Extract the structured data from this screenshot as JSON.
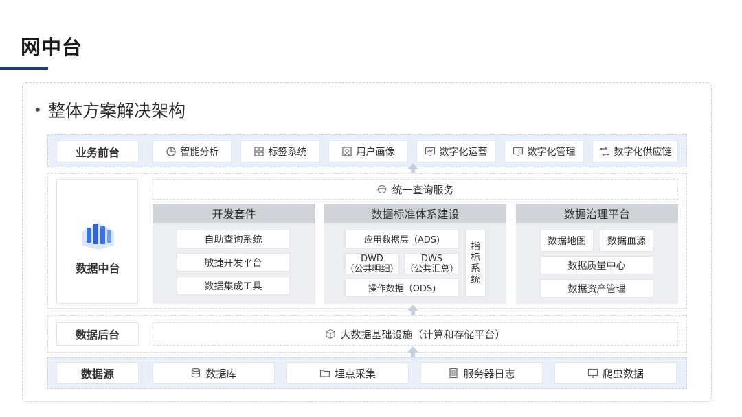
{
  "page": {
    "title": "网中台",
    "heading": "整体方案解决架构"
  },
  "front": {
    "label": "业务前台",
    "items": [
      {
        "label": "智能分析",
        "icon": "pie-chart-icon"
      },
      {
        "label": "标签系统",
        "icon": "grid-icon"
      },
      {
        "label": "用户画像",
        "icon": "portrait-icon"
      },
      {
        "label": "数字化运营",
        "icon": "monitor-chart-icon"
      },
      {
        "label": "数字化管理",
        "icon": "monitor-gear-icon"
      },
      {
        "label": "数字化供应链",
        "icon": "supply-chain-icon"
      }
    ]
  },
  "middle": {
    "label": "数据中台",
    "query_service": "统一查询服务",
    "dev_suite": {
      "title": "开发套件",
      "items": [
        "自助查询系统",
        "敏捷开发平台",
        "数据集成工具"
      ]
    },
    "standard": {
      "title": "数据标准体系建设",
      "ads": "应用数据层（ADS)",
      "dwd_line1": "DWD",
      "dwd_line2": "（公共明细）",
      "dws_line1": "DWS",
      "dws_line2": "（公共汇总）",
      "ods": "操作数据（ODS)",
      "metric": [
        "指",
        "标",
        "系",
        "统"
      ]
    },
    "governance": {
      "title": "数据治理平台",
      "map": "数据地图",
      "lineage": "数据血源",
      "quality": "数据质量中心",
      "asset": "数据资产管理"
    }
  },
  "back": {
    "label": "数据后台",
    "infra": "大数据基础设施（计算和存储平台）"
  },
  "source": {
    "label": "数据源",
    "items": [
      {
        "label": "数据库",
        "icon": "database-icon"
      },
      {
        "label": "埋点采集",
        "icon": "folder-icon"
      },
      {
        "label": "服务器日志",
        "icon": "log-icon"
      },
      {
        "label": "爬虫数据",
        "icon": "monitor-icon"
      }
    ]
  },
  "colors": {
    "accent": "#1f3f73",
    "band": "#e9eff8",
    "arrow": "#c5cfdf",
    "panel_head": "#cfd2d7",
    "panel_body": "#eceef1",
    "logo_blue": "#3b74e8"
  }
}
